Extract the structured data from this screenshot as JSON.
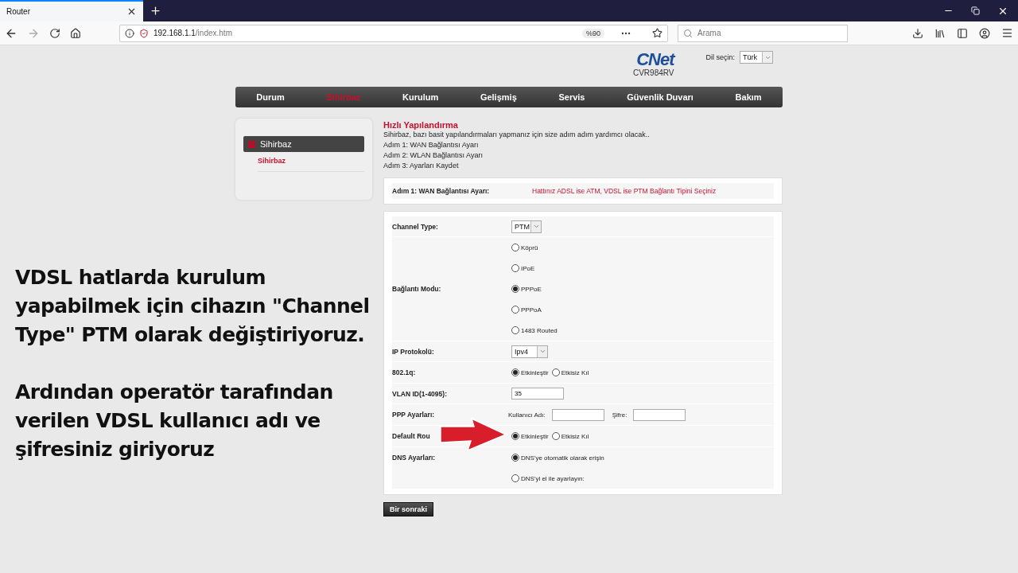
{
  "browser": {
    "tab_title": "Router",
    "address_host": "192.168.1.1",
    "address_path": "/index.htm",
    "zoom": "%90",
    "search_placeholder": "Arama"
  },
  "header": {
    "logo": "CNet",
    "model": "CVR984RV",
    "language_label": "Dil seçin:",
    "language": "Türk"
  },
  "nav": [
    {
      "label": "Durum",
      "selected": false
    },
    {
      "label": "Sihirbaz",
      "selected": true
    },
    {
      "label": "Kurulum",
      "selected": false
    },
    {
      "label": "Gelişmiş",
      "selected": false
    },
    {
      "label": "Servis",
      "selected": false
    },
    {
      "label": "Güvenlik Duvarı",
      "selected": false
    },
    {
      "label": "Bakım",
      "selected": false
    }
  ],
  "sidebar": {
    "heading": "Sihirbaz",
    "links": [
      {
        "label": "Sihirbaz",
        "selected": true
      }
    ]
  },
  "content": {
    "title": "Hızlı Yapılandırma",
    "lines": [
      "Sihirbaz, bazı basit yapılandırmaları yapmanız için size adım adım yardımcı olacak..",
      "Adım 1: WAN Bağlantısı Ayarı",
      "Adım 2: WLAN Bağlantısı Ayarı",
      "Adım 3: Ayarları Kaydet"
    ]
  },
  "step": {
    "label": "Adım 1: WAN Bağlantısı Ayarı:",
    "note": "Hattınız ADSL ise ATM, VDSL ise PTM Bağlantı Tipini Seçiniz"
  },
  "form": [
    {
      "kind": "select",
      "label": "Channel Type:",
      "value": "PTM"
    },
    {
      "kind": "radio_stack",
      "label": "Bağlantı Modu:",
      "options": [
        {
          "label": "Köprü",
          "selected": false
        },
        {
          "label": "IPoE",
          "selected": false
        },
        {
          "label": "PPPoE",
          "selected": true
        },
        {
          "label": "PPPoA",
          "selected": false
        },
        {
          "label": "1483 Routed",
          "selected": false
        }
      ]
    },
    {
      "kind": "select",
      "label": "IP Protokolü:",
      "value": "Ipv4"
    },
    {
      "kind": "radio_inline",
      "label": "802.1q:",
      "options": [
        {
          "label": "Etkinleştir",
          "selected": true
        },
        {
          "label": "Etkisiz Kıl",
          "selected": false
        }
      ]
    },
    {
      "kind": "text",
      "label": "VLAN ID(1-4095):",
      "value": "35"
    },
    {
      "kind": "credentials",
      "label": "PPP Ayarları:",
      "fields": [
        {
          "label": "Kullanıcı Adı:"
        },
        {
          "label": "Şifre:"
        }
      ]
    },
    {
      "kind": "radio_inline",
      "label": "Default Rou",
      "options": [
        {
          "label": "Etkinleştir",
          "selected": true
        },
        {
          "label": "Etkisiz Kıl",
          "selected": false
        }
      ]
    },
    {
      "kind": "radio_list",
      "label": "DNS Ayarları:",
      "options": [
        {
          "label": "DNS'ye otomatik olarak erişin",
          "selected": true
        },
        {
          "label": "DNS'yi el ile ayarlayın:",
          "selected": false
        }
      ]
    }
  ],
  "next_button": "Bir sonraki",
  "caption": [
    "VDSL hatlarda kurulum yapabilmek için cihazın \"Channel Type\" PTM olarak değiştiriyoruz.",
    "Ardından operatör tarafından verilen VDSL kullanıcı adı ve şifresiniz giriyoruz"
  ]
}
